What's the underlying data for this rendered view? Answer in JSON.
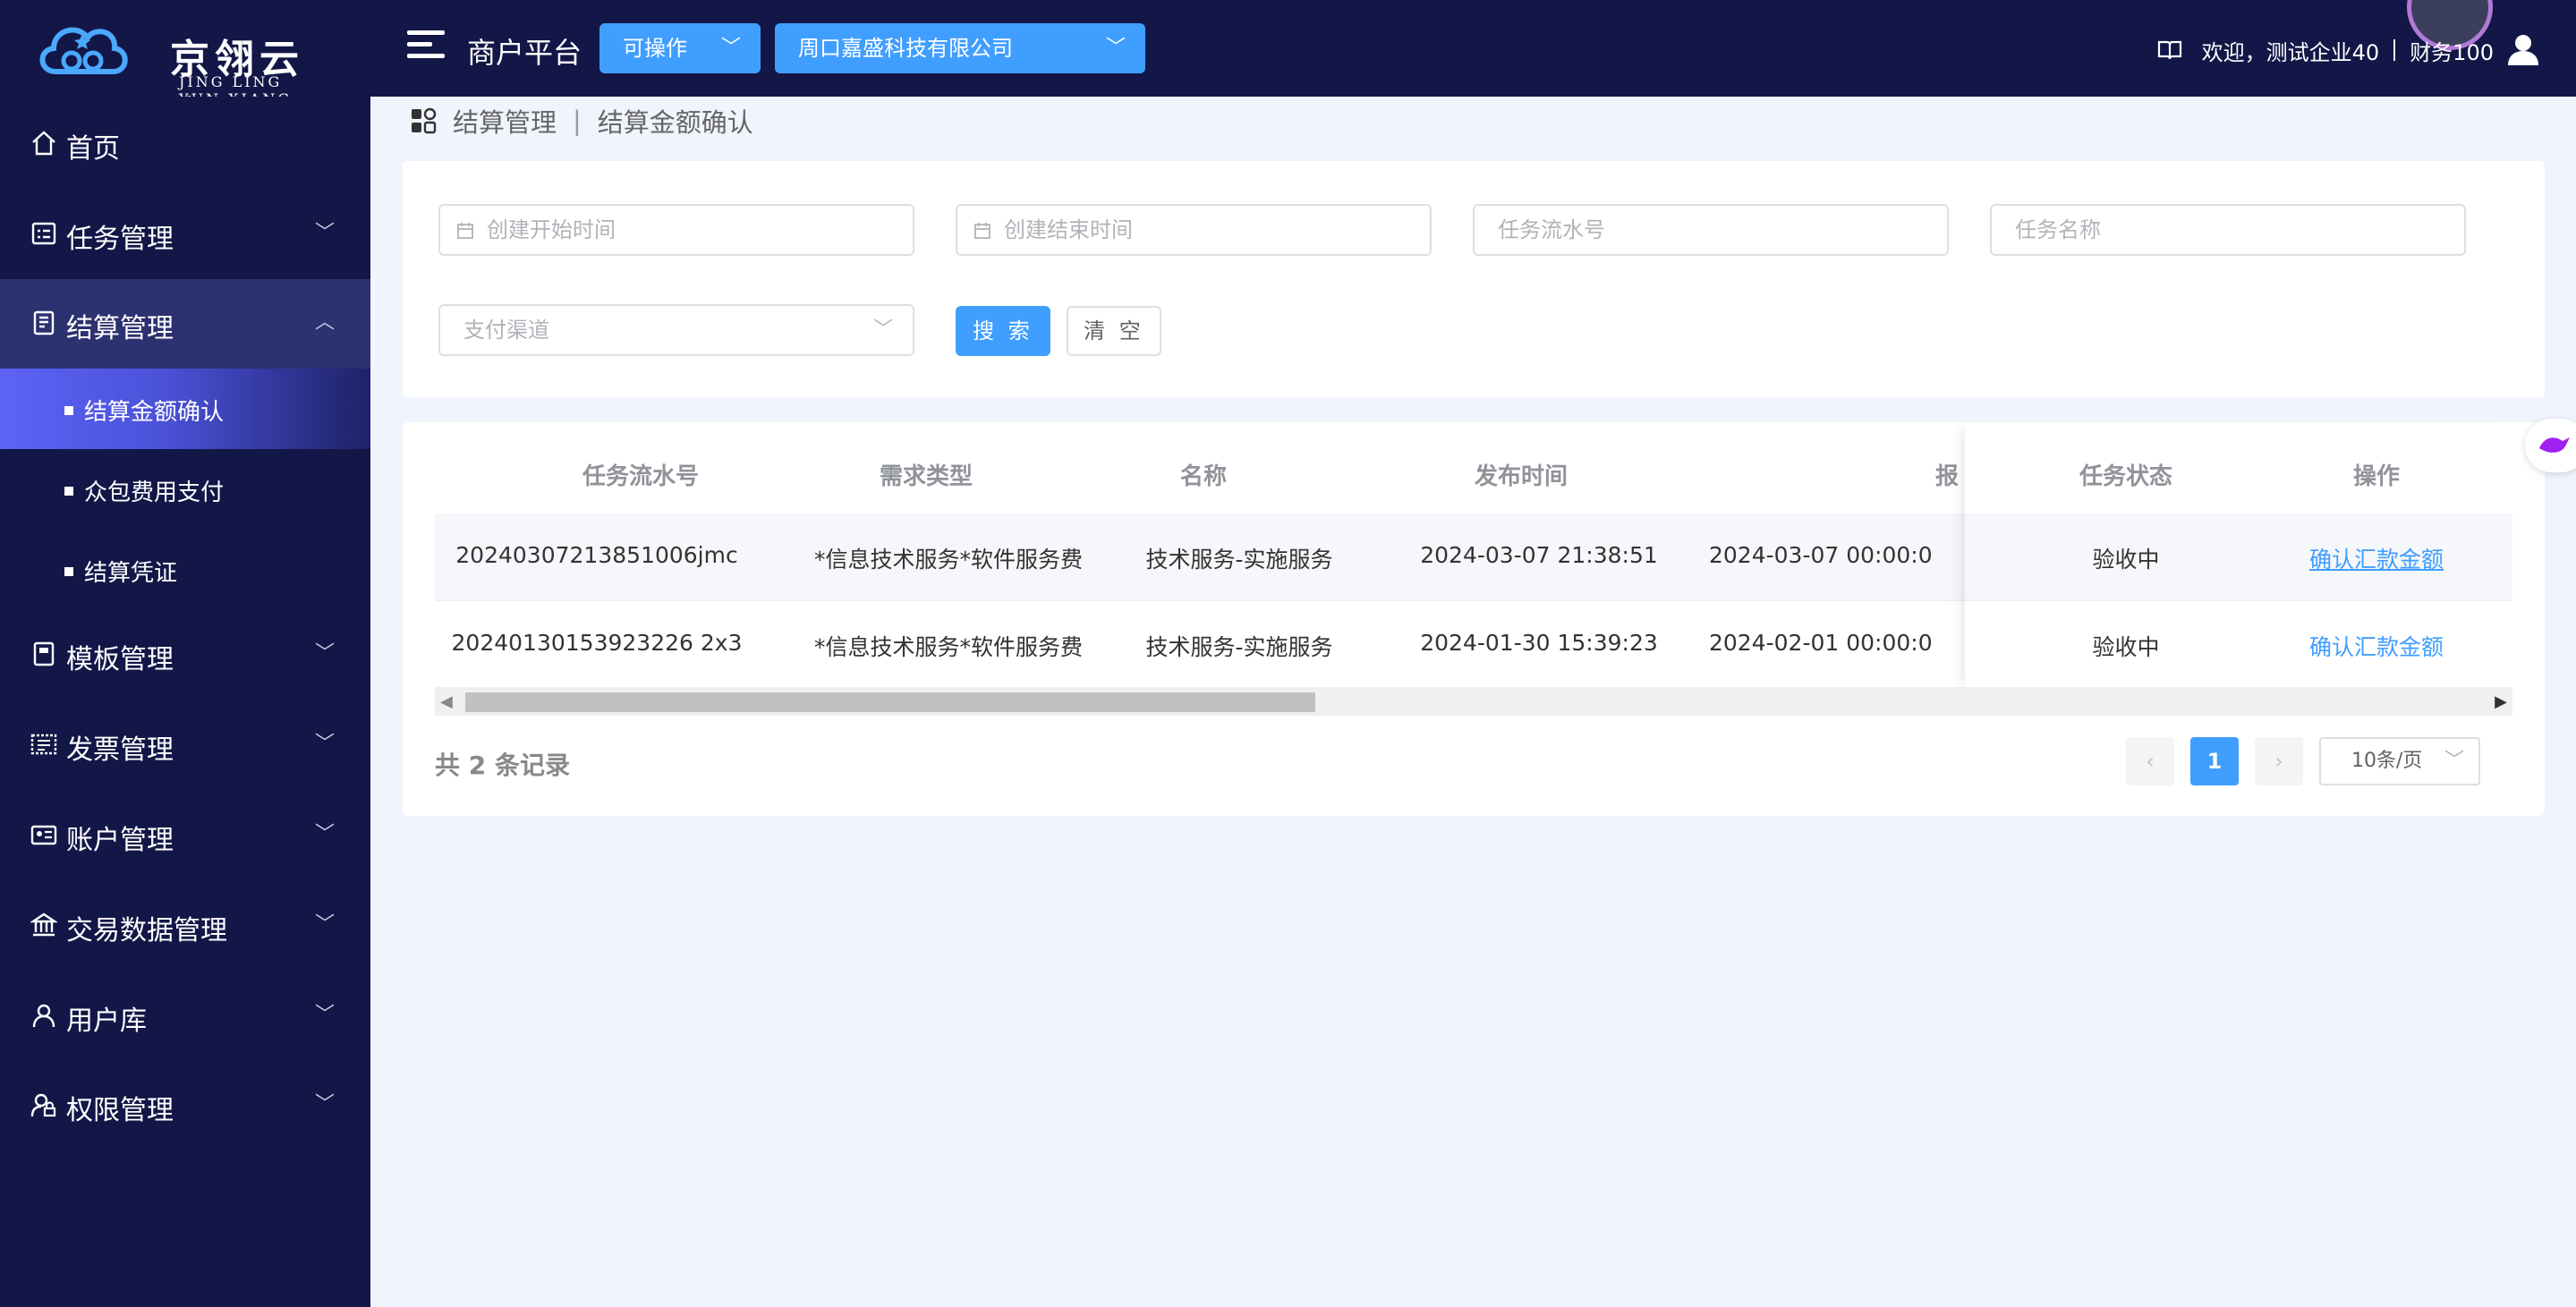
{
  "header": {
    "logo_cn": "京翎云享",
    "logo_en": "JING LING YUN XIANG",
    "platform_title": "商户平台",
    "status_select": "可操作",
    "company_select": "周口嘉盛科技有限公司",
    "welcome": "欢迎，测试企业40",
    "user_name": "财务100"
  },
  "sidebar": {
    "items": [
      {
        "label": "首页",
        "icon": "home-icon"
      },
      {
        "label": "任务管理",
        "icon": "task-icon"
      },
      {
        "label": "结算管理",
        "icon": "settlement-icon"
      },
      {
        "label": "模板管理",
        "icon": "template-icon"
      },
      {
        "label": "发票管理",
        "icon": "invoice-icon"
      },
      {
        "label": "账户管理",
        "icon": "account-icon"
      },
      {
        "label": "交易数据管理",
        "icon": "bank-icon"
      },
      {
        "label": "用户库",
        "icon": "user-icon"
      },
      {
        "label": "权限管理",
        "icon": "permission-icon"
      }
    ],
    "sub_items": [
      {
        "label": "结算金额确认"
      },
      {
        "label": "众包费用支付"
      },
      {
        "label": "结算凭证"
      }
    ]
  },
  "breadcrumb": {
    "parent": "结算管理",
    "current": "结算金额确认"
  },
  "filters": {
    "start_time_placeholder": "创建开始时间",
    "end_time_placeholder": "创建结束时间",
    "serial_placeholder": "任务流水号",
    "task_name_placeholder": "任务名称",
    "pay_channel_placeholder": "支付渠道",
    "search_label": "搜 索",
    "clear_label": "清 空"
  },
  "table": {
    "headers": [
      "任务流水号",
      "需求类型",
      "名称",
      "发布时间",
      "报",
      "任务状态",
      "操作"
    ],
    "rows": [
      {
        "serial": "20240307213851006jmc",
        "type": "*信息技术服务*软件服务费",
        "name": "技术服务-实施服务",
        "publish_time": "2024-03-07 21:38:51",
        "report_time": "2024-03-07 00:00:0",
        "status": "验收中",
        "action": "确认汇款金额"
      },
      {
        "serial": "20240130153923226 2x3",
        "type": "*信息技术服务*软件服务费",
        "name": "技术服务-实施服务",
        "publish_time": "2024-01-30 15:39:23",
        "report_time": "2024-02-01 00:00:0",
        "status": "验收中",
        "action": "确认汇款金额"
      }
    ]
  },
  "pagination": {
    "total": "共 2 条记录",
    "current_page": "1",
    "page_size": "10条/页"
  },
  "colors": {
    "primary": "#409eff",
    "nav_bg": "#131747",
    "page_bg": "#f0f4fc"
  }
}
